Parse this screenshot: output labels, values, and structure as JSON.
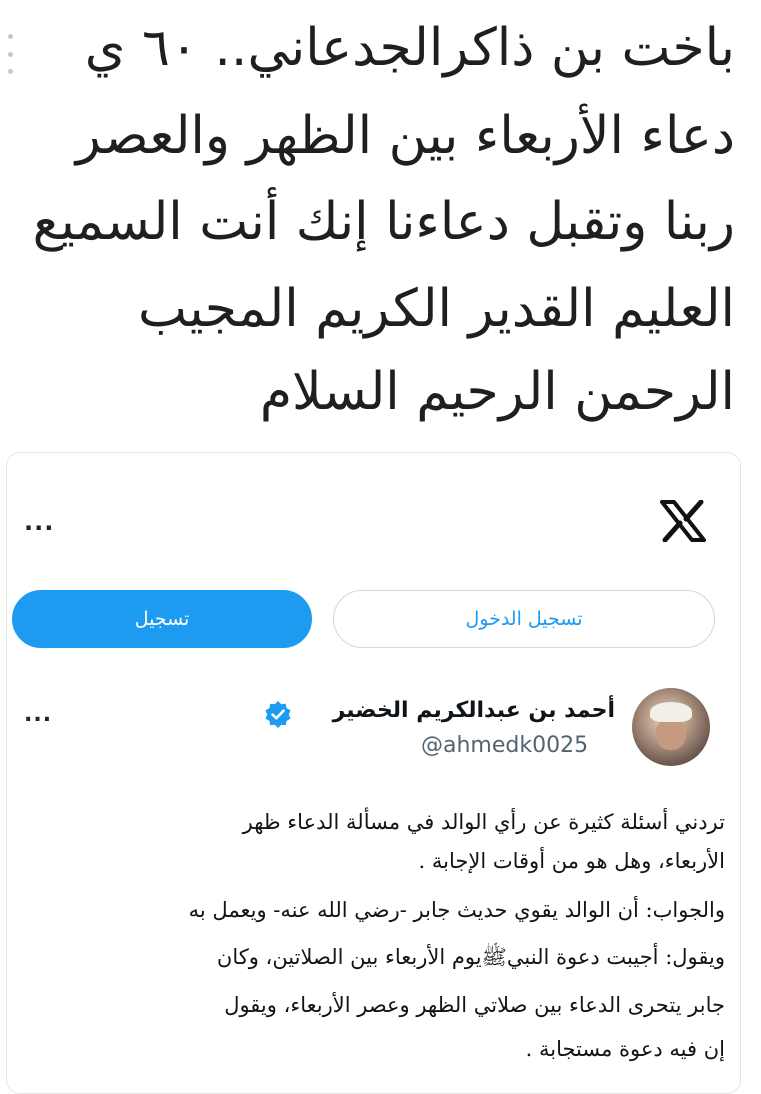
{
  "header": {
    "title_lines": [
      "باخت بن ذاكرالجدعاني.. ٦٠ ي",
      "دعاء الأربعاء بين الظهر والعصر",
      "ربنا وتقبل دعاءنا إنك أنت السميع",
      "العليم القدير الكريم المجيب",
      "الرحمن الرحيم السلام"
    ]
  },
  "card": {
    "more_label": "...",
    "logo": "x-logo-icon",
    "signup_label": "تسجيل",
    "login_label": "تسجيل الدخول",
    "accent_color": "#1d9bf0"
  },
  "post": {
    "display_name": "أحمد بن عبدالكريم الخضير",
    "handle": "@ahmedk0025",
    "verified": true,
    "more_label": "...",
    "body_lines": [
      "تردني أسئلة كثيرة عن رأي الوالد في مسألة الدعاء ظهر",
      "الأربعاء، وهل هو من أوقات الإجابة .",
      "والجواب: أن الوالد يقوي حديث جابر -رضي الله عنه- ويعمل به",
      "ويقول: أجيبت دعوة النبيﷺيوم الأربعاء بين الصلاتين، وكان",
      "جابر يتحرى الدعاء بين صلاتي الظهر وعصر الأربعاء، ويقول",
      "إن فيه دعوة مستجابة ."
    ]
  }
}
